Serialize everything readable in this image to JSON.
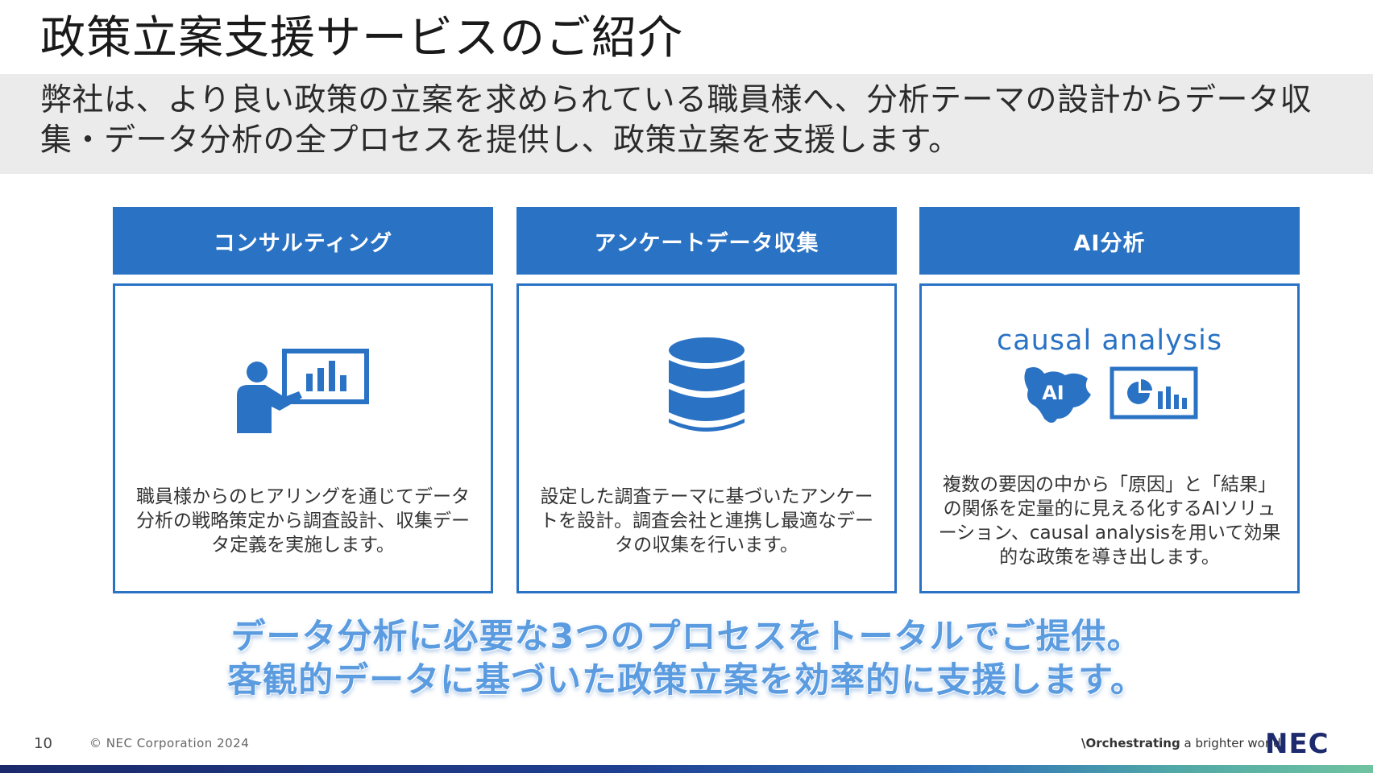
{
  "title": "政策立案支援サービスのご紹介",
  "lead": "弊社は、より良い政策の立案を求められている職員様へ、分析テーマの設計からデータ収集・データ分析の全プロセスを提供し、政策立案を支援します。",
  "columns": [
    {
      "heading": "コンサルティング",
      "icon": "presenter-chart-icon",
      "text": "職員様からのヒアリングを通じてデータ分析の戦略策定から調査設計、収集データ定義を実施します。"
    },
    {
      "heading": "アンケートデータ収集",
      "icon": "database-icon",
      "text": "設定した調査テーマに基づいたアンケートを設計。調査会社と連携し最適なデータの収集を行います。"
    },
    {
      "heading": "AI分析",
      "icon": "ai-analysis-icon",
      "label": "causal analysis",
      "ai_badge": "AI",
      "text": "複数の要因の中から「原因」と「結果」の関係を定量的に見える化するAIソリューション、causal analysisを用いて効果的な政策を導き出します。"
    }
  ],
  "summary": {
    "line1": "データ分析に必要な3つのプロセスをトータルでご提供。",
    "line2": "客観的データに基づいた政策立案を効率的に支援します。"
  },
  "footer": {
    "page_number": "10",
    "copyright": "© NEC Corporation 2024",
    "tagline_bold": "\\Orchestrating",
    "tagline_rest": " a brighter world",
    "logo": "NEC"
  },
  "colors": {
    "accent": "#2a72c4",
    "summary_text": "#5b9be0",
    "band": "#ebebeb"
  }
}
